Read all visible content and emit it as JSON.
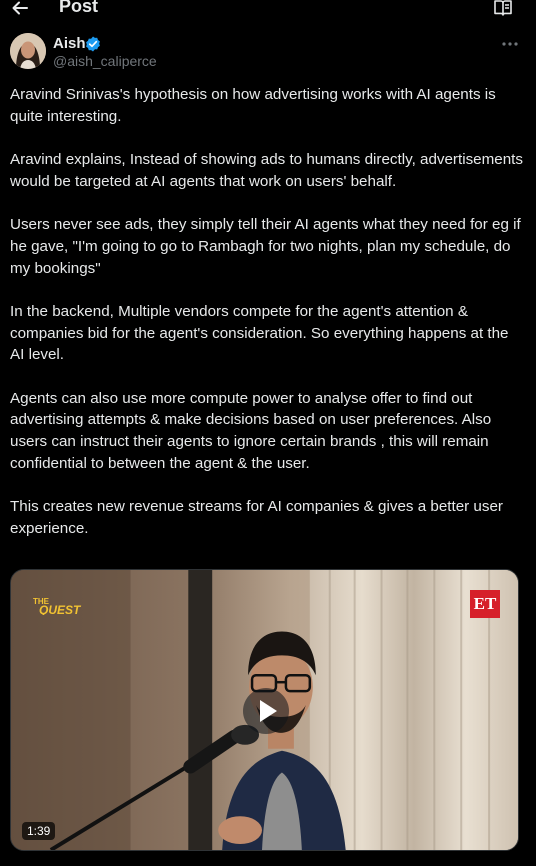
{
  "header": {
    "title": "Post",
    "back_icon": "arrow-left-icon",
    "reader_icon": "open-book-icon"
  },
  "author": {
    "name": "Aish",
    "handle": "@aish_caliperce",
    "verified": true
  },
  "post": {
    "paragraphs": [
      "Aravind Srinivas's hypothesis on how advertising works with AI agents is quite interesting.",
      "Aravind explains, Instead of showing ads to humans directly, advertisements would be targeted at AI agents that work on users' behalf.",
      "Users never see ads, they simply tell their AI agents what they need for eg if he gave, \"I'm going to go to Rambagh for two nights, plan my schedule, do my bookings\"",
      "In the backend, Multiple vendors compete for the agent's attention & companies bid for the agent's consideration. So everything happens at the AI level.",
      "Agents can also use more compute power to analyse offer to find out advertising attempts & make decisions based on user preferences. Also users can instruct their agents to ignore certain brands , this will remain confidential to between the agent & the user.",
      "This creates new revenue streams for AI companies & gives a better user experience."
    ]
  },
  "media": {
    "show_logo": "THE QUEST",
    "channel_logo": "ET",
    "duration": "1:39"
  },
  "colors": {
    "background": "#000000",
    "text": "#e7e9ea",
    "muted": "#71767b",
    "verified": "#1d9bf0",
    "et_red": "#d6202a"
  }
}
